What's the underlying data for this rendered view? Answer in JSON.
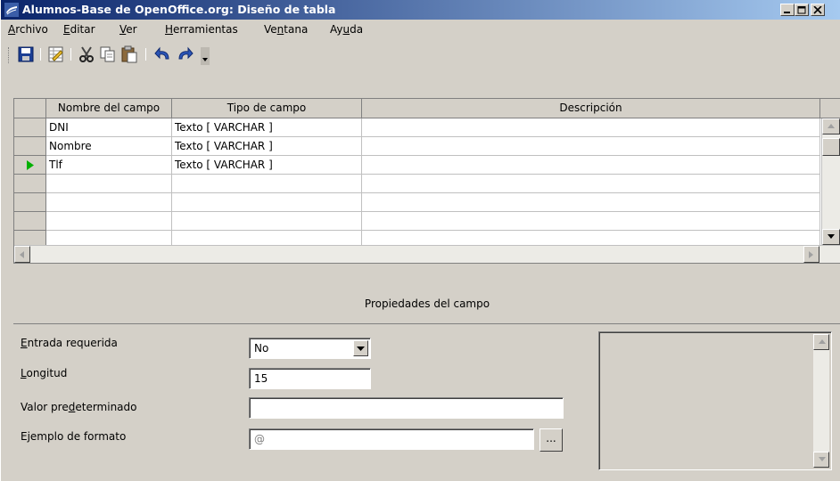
{
  "window": {
    "title": "Alumnos-Base de OpenOffice.org: Diseño de tabla"
  },
  "menu": [
    {
      "key": "A",
      "rest": "rchivo"
    },
    {
      "key": "E",
      "rest": "ditar"
    },
    {
      "key": "V",
      "rest": "er"
    },
    {
      "key": "H",
      "rest": "erramientas"
    },
    {
      "pre": "Ve",
      "key": "n",
      "rest": "tana"
    },
    {
      "pre": "Ay",
      "key": "u",
      "rest": "da"
    }
  ],
  "toolbar": {
    "icons": [
      "save-icon",
      "edit-table-icon",
      "cut-icon",
      "copy-icon",
      "paste-icon",
      "undo-icon",
      "redo-icon"
    ]
  },
  "grid": {
    "headers": [
      "Nombre del campo",
      "Tipo de campo",
      "Descripción"
    ],
    "rows": [
      {
        "name": "DNI",
        "type": "Texto [ VARCHAR ]",
        "desc": "",
        "current": false
      },
      {
        "name": "Nombre",
        "type": "Texto [ VARCHAR ]",
        "desc": "",
        "current": false
      },
      {
        "name": "Tlf",
        "type": "Texto [ VARCHAR ]",
        "desc": "",
        "current": true
      },
      {
        "name": "",
        "type": "",
        "desc": "",
        "current": false
      },
      {
        "name": "",
        "type": "",
        "desc": "",
        "current": false
      },
      {
        "name": "",
        "type": "",
        "desc": "",
        "current": false
      },
      {
        "name": "",
        "type": "",
        "desc": "",
        "current": false
      }
    ]
  },
  "properties": {
    "title": "Propiedades del campo",
    "required_label": {
      "key": "E",
      "rest": "ntrada requerida"
    },
    "required_value": "No",
    "length_label": {
      "key": "L",
      "rest": "ongitud"
    },
    "length_value": "15",
    "default_label": {
      "pre": "Valor pre",
      "key": "d",
      "rest": "eterminado"
    },
    "default_value": "",
    "format_label": "Ejemplo de formato",
    "format_value": "@",
    "format_button": "..."
  },
  "colors": {
    "title_start": "#0a246a",
    "title_end": "#a6caf0",
    "current_row_arrow": "#00b000"
  }
}
